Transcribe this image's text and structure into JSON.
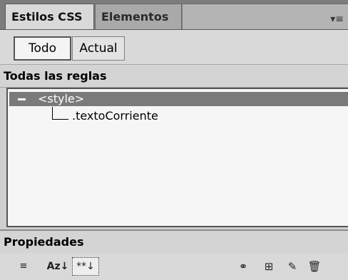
{
  "tabs": [
    {
      "label": "Estilos CSS"
    },
    {
      "label": "Elementos PA"
    }
  ],
  "panel_menu_icon": "panel-menu-icon",
  "mode_buttons": {
    "all": "Todo",
    "current": "Actual"
  },
  "rules_section": {
    "title": "Todas las reglas"
  },
  "tree": {
    "root": {
      "label": "<style>",
      "expanded": true,
      "selected": true
    },
    "children": [
      {
        "label": ".textoCorriente"
      }
    ]
  },
  "properties_section": {
    "title": "Propiedades"
  },
  "toolbar": {
    "category_view_icon": "≡",
    "alpha_view_icon": "Az↓",
    "set_props_icon": "**↓",
    "link_icon": "⚭",
    "new_rule_icon": "⊞",
    "edit_icon": "✎",
    "delete_icon": "🗑"
  },
  "colors": {
    "selected_row": "#7a7a7a",
    "panel_bg": "#d9d9d9",
    "tab_bar": "#7c7c7c"
  }
}
